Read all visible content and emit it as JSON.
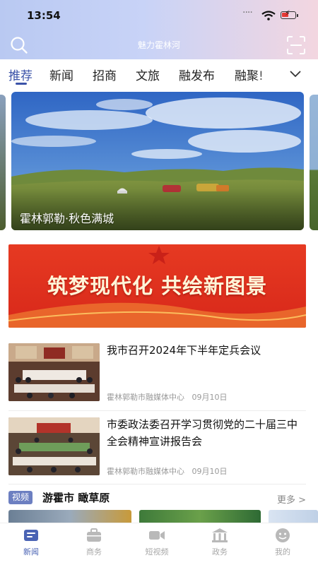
{
  "status_bar": {
    "time": "13:54"
  },
  "header": {
    "app_title": "魅力霍林河",
    "search_icon": "search-icon",
    "scan_icon": "scan-icon"
  },
  "tabs": [
    {
      "label": "推荐",
      "active": true
    },
    {
      "label": "新闻"
    },
    {
      "label": "招商"
    },
    {
      "label": "文旅"
    },
    {
      "label": "融发布"
    },
    {
      "label": "融聚!"
    }
  ],
  "carousel": {
    "caption": "霍林郭勒·秋色满城"
  },
  "promo_banner": {
    "text": "筑梦现代化 共绘新图景"
  },
  "news": [
    {
      "title": "我市召开2024年下半年定兵会议",
      "source": "霍林郭勒市融媒体中心",
      "date": "09月10日"
    },
    {
      "title": "市委政法委召开学习贯彻党的二十届三中全会精神宣讲报告会",
      "source": "霍林郭勒市融媒体中心",
      "date": "09月10日"
    }
  ],
  "video_section": {
    "badge": "视频",
    "title": "游霍市 瞰草原",
    "more": "更多 >"
  },
  "tab_bar": [
    {
      "label": "新闻",
      "icon": "news-icon",
      "active": true
    },
    {
      "label": "商务",
      "icon": "briefcase-icon"
    },
    {
      "label": "短视频",
      "icon": "video-camera-icon"
    },
    {
      "label": "政务",
      "icon": "government-building-icon"
    },
    {
      "label": "我的",
      "icon": "user-face-icon"
    }
  ],
  "colors": {
    "accent": "#3a52a8",
    "promo_red": "#e0311f",
    "badge": "#6c7fc1"
  }
}
